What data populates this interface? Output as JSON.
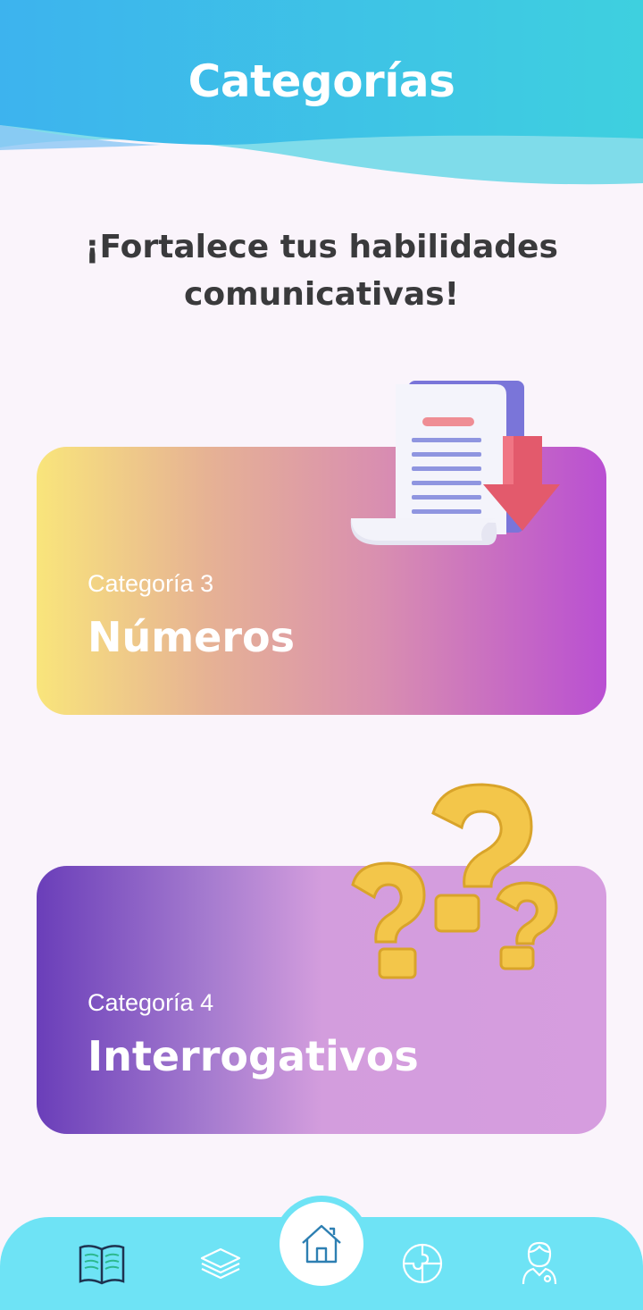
{
  "header": {
    "title": "Categorías"
  },
  "subtitle": "¡Fortalece tus habilidades comunicativas!",
  "categories": [
    {
      "label": "Categoría 3",
      "name": "Números",
      "illustration": "document-download-icon"
    },
    {
      "label": "Categoría 4",
      "name": "Interrogativos",
      "illustration": "question-marks-icon"
    }
  ],
  "nav": {
    "items": [
      {
        "icon": "book-icon",
        "active": false
      },
      {
        "icon": "layers-icon",
        "active": false
      },
      {
        "icon": "home-icon",
        "active": true
      },
      {
        "icon": "puzzle-icon",
        "active": false
      },
      {
        "icon": "profile-icon",
        "active": false
      }
    ]
  },
  "colors": {
    "header_start": "#3fb6ec",
    "header_end": "#3ecfdf",
    "nav_background": "#6ee3f5",
    "background": "#faf4fb"
  }
}
